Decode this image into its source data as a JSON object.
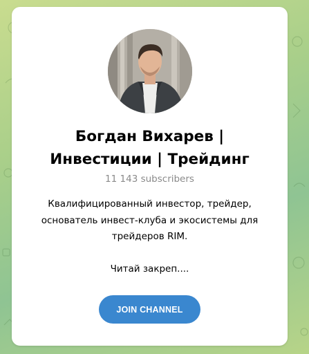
{
  "channel": {
    "title_line1": "Богдан Вихарев |",
    "title_line2": "Инвестиции | Трейдинг",
    "subscribers": "11 143 subscribers",
    "description": {
      "line1": "Квалифицированный инвестор, трейдер,",
      "line2": "основатель инвест-клуба и экосистемы для",
      "line3": "трейдеров RIM.",
      "line4": "Читай закреп...."
    },
    "join_label": "JOIN CHANNEL"
  },
  "colors": {
    "accent": "#3a87cf",
    "card_background": "#ffffff",
    "muted_text": "#8a8a8a"
  },
  "icons": {
    "avatar": "channel-avatar-photo"
  }
}
